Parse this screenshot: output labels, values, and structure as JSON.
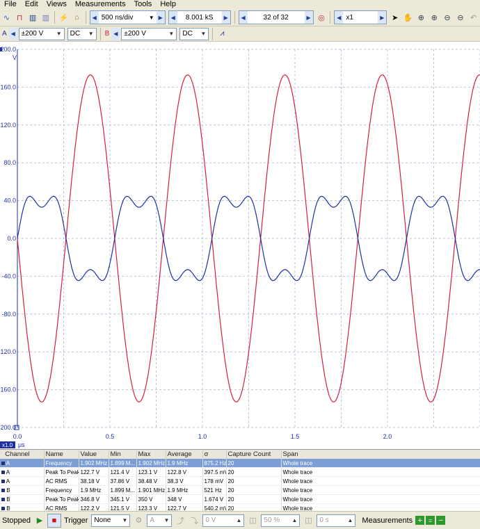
{
  "menu": [
    "File",
    "Edit",
    "Views",
    "Measurements",
    "Tools",
    "Help"
  ],
  "toolbar": {
    "timebase": "500 ns/div",
    "samples": "8.001 kS",
    "capture": "32 of 32",
    "zoom": "x1"
  },
  "channels": {
    "a": {
      "label": "A",
      "range": "±200 V",
      "coupling": "DC"
    },
    "b": {
      "label": "B",
      "range": "±200 V",
      "coupling": "DC"
    }
  },
  "chart_data": {
    "type": "line",
    "yunit": "V",
    "xunit": "μs",
    "xscale_label": "x1.0",
    "xlim": [
      0,
      2.5
    ],
    "ylim": [
      -200,
      200
    ],
    "y_ticks": [
      "200.0",
      "160.0",
      "120.0",
      "80.0",
      "40.0",
      "0.0",
      "-40.0",
      "-80.0",
      "-120.0",
      "-160.0",
      "-200.0"
    ],
    "x_ticks": [
      "0.0",
      "0.5",
      "1.0",
      "1.5",
      "2.0"
    ],
    "x_tick_values": [
      0,
      0.5,
      1.0,
      1.5,
      2.0
    ],
    "series": [
      {
        "color": "#d21f3c",
        "frequency_mhz": 1.902,
        "amplitude_v": 173,
        "phase_deg": -180,
        "harmonics": []
      },
      {
        "color": "#1f2fa5",
        "frequency_mhz": 1.902,
        "amplitude_v": 48,
        "phase_deg": 0,
        "harmonics": [
          {
            "order": 3,
            "amplitude_v": 15
          }
        ]
      }
    ],
    "grid": true
  },
  "measurements": {
    "headers": [
      "Channel",
      "Name",
      "Value",
      "Min",
      "Max",
      "Average",
      "σ",
      "Capture Count",
      "Span"
    ],
    "rows": [
      [
        "A",
        "Frequency",
        "1.902 MHz",
        "1.899 M...",
        "1.902 MHz",
        "1.9 MHz",
        "875.2 Hz",
        "20",
        "Whole trace"
      ],
      [
        "A",
        "Peak To Peak",
        "122.7 V",
        "121.4 V",
        "123.1 V",
        "122.8 V",
        "397.5 mV",
        "20",
        "Whole trace"
      ],
      [
        "A",
        "AC RMS",
        "38.18 V",
        "37.86 V",
        "38.48 V",
        "38.3 V",
        "178 mV",
        "20",
        "Whole trace"
      ],
      [
        "B",
        "Frequency",
        "1.9 MHz",
        "1.899 M...",
        "1.901 MHz",
        "1.9 MHz",
        "521 Hz",
        "20",
        "Whole trace"
      ],
      [
        "B",
        "Peak To Peak",
        "346.8 V",
        "345.1 V",
        "350 V",
        "348 V",
        "1.674 V",
        "20",
        "Whole trace"
      ],
      [
        "B",
        "AC RMS",
        "122.2 V",
        "121.5 V",
        "123.3 V",
        "122.7 V",
        "540.2 mV",
        "20",
        "Whole trace"
      ]
    ]
  },
  "status": {
    "state": "Stopped",
    "trigger_label": "Trigger",
    "trigger_mode": "None",
    "trigger_channel": "A",
    "trigger_level": "0 V",
    "trigger_pct": "50 %",
    "trigger_delay": "0 s",
    "measurements_label": "Measurements"
  }
}
